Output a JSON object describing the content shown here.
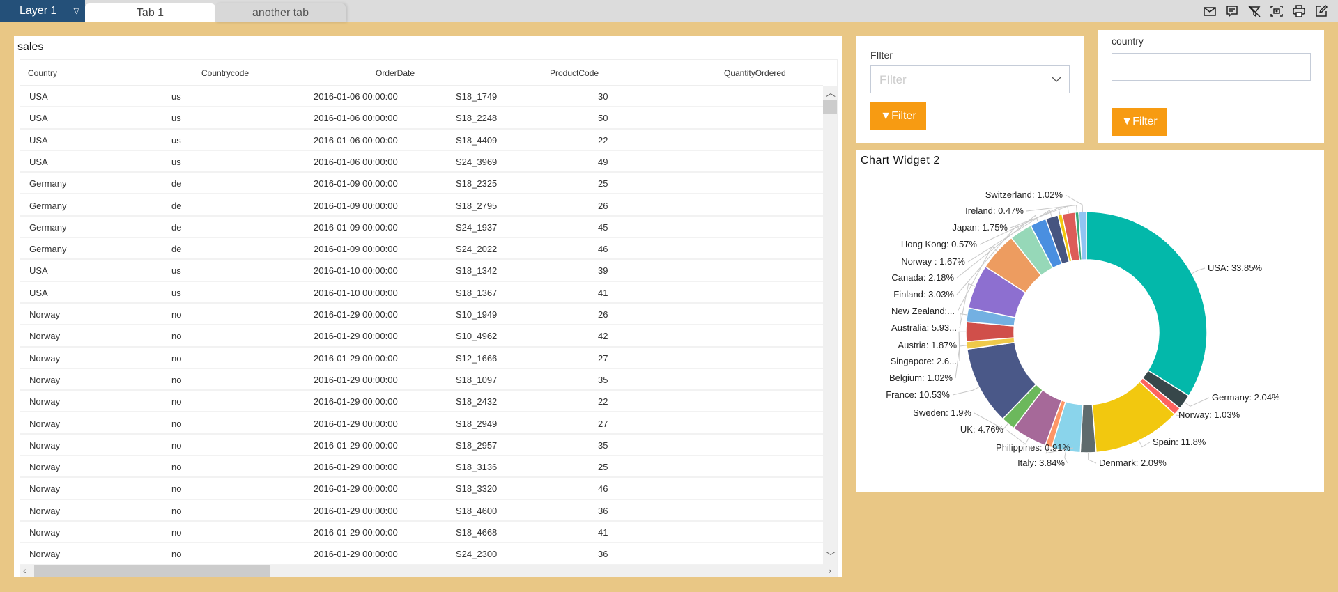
{
  "topbar": {
    "layer": "Layer 1",
    "tabs": [
      "Tab 1",
      "another tab"
    ],
    "icons": [
      "mail-icon",
      "comment-icon",
      "clear-filter-icon",
      "screenshot-icon",
      "print-icon",
      "edit-icon"
    ]
  },
  "sales": {
    "title": "sales",
    "columns": [
      "Country",
      "Countrycode",
      "OrderDate",
      "ProductCode",
      "QuantityOrdered"
    ],
    "rows": [
      [
        "USA",
        "us",
        "2016-01-06 00:00:00",
        "S18_1749",
        "30"
      ],
      [
        "USA",
        "us",
        "2016-01-06 00:00:00",
        "S18_2248",
        "50"
      ],
      [
        "USA",
        "us",
        "2016-01-06 00:00:00",
        "S18_4409",
        "22"
      ],
      [
        "USA",
        "us",
        "2016-01-06 00:00:00",
        "S24_3969",
        "49"
      ],
      [
        "Germany",
        "de",
        "2016-01-09 00:00:00",
        "S18_2325",
        "25"
      ],
      [
        "Germany",
        "de",
        "2016-01-09 00:00:00",
        "S18_2795",
        "26"
      ],
      [
        "Germany",
        "de",
        "2016-01-09 00:00:00",
        "S24_1937",
        "45"
      ],
      [
        "Germany",
        "de",
        "2016-01-09 00:00:00",
        "S24_2022",
        "46"
      ],
      [
        "USA",
        "us",
        "2016-01-10 00:00:00",
        "S18_1342",
        "39"
      ],
      [
        "USA",
        "us",
        "2016-01-10 00:00:00",
        "S18_1367",
        "41"
      ],
      [
        "Norway",
        "no",
        "2016-01-29 00:00:00",
        "S10_1949",
        "26"
      ],
      [
        "Norway",
        "no",
        "2016-01-29 00:00:00",
        "S10_4962",
        "42"
      ],
      [
        "Norway",
        "no",
        "2016-01-29 00:00:00",
        "S12_1666",
        "27"
      ],
      [
        "Norway",
        "no",
        "2016-01-29 00:00:00",
        "S18_1097",
        "35"
      ],
      [
        "Norway",
        "no",
        "2016-01-29 00:00:00",
        "S18_2432",
        "22"
      ],
      [
        "Norway",
        "no",
        "2016-01-29 00:00:00",
        "S18_2949",
        "27"
      ],
      [
        "Norway",
        "no",
        "2016-01-29 00:00:00",
        "S18_2957",
        "35"
      ],
      [
        "Norway",
        "no",
        "2016-01-29 00:00:00",
        "S18_3136",
        "25"
      ],
      [
        "Norway",
        "no",
        "2016-01-29 00:00:00",
        "S18_3320",
        "46"
      ],
      [
        "Norway",
        "no",
        "2016-01-29 00:00:00",
        "S18_4600",
        "36"
      ],
      [
        "Norway",
        "no",
        "2016-01-29 00:00:00",
        "S18_4668",
        "41"
      ],
      [
        "Norway",
        "no",
        "2016-01-29 00:00:00",
        "S24_2300",
        "36"
      ]
    ]
  },
  "filter1": {
    "label": "FIlter",
    "placeholder": "FIlter",
    "button": "Filter"
  },
  "filter2": {
    "label": "country",
    "value": "",
    "button": "Filter"
  },
  "accent": "#f79b12",
  "chart_data": {
    "type": "pie",
    "donut": true,
    "title": "Chart Widget 2",
    "unit": "%",
    "slices": [
      {
        "name": "USA",
        "value": 33.85,
        "label": "USA: 33.85%",
        "color": "#03b8aa"
      },
      {
        "name": "Germany",
        "value": 2.04,
        "label": "Germany: 2.04%",
        "color": "#37474a"
      },
      {
        "name": "Norway",
        "value": 1.03,
        "label": "Norway: 1.03%",
        "color": "#fd625e"
      },
      {
        "name": "Spain",
        "value": 11.8,
        "label": "Spain: 11.8%",
        "color": "#f2c80f"
      },
      {
        "name": "Denmark",
        "value": 2.09,
        "label": "Denmark: 2.09%",
        "color": "#5f6b6d"
      },
      {
        "name": "Italy",
        "value": 3.84,
        "label": "Italy: 3.84%",
        "color": "#8ad4eb"
      },
      {
        "name": "Philippines",
        "value": 0.91,
        "label": "Philippines: 0.91%",
        "color": "#fe9666"
      },
      {
        "name": "UK",
        "value": 4.76,
        "label": "UK: 4.76%",
        "color": "#a66999"
      },
      {
        "name": "Sweden",
        "value": 1.9,
        "label": "Sweden: 1.9%",
        "color": "#6cb85c"
      },
      {
        "name": "France",
        "value": 10.53,
        "label": "France: 10.53%",
        "color": "#4a5888"
      },
      {
        "name": "Belgium",
        "value": 1.02,
        "label": "Belgium: 1.02%",
        "color": "#efc94a"
      },
      {
        "name": "Singapore",
        "value": 2.6,
        "label": "Singapore: 2.6...",
        "color": "#d04f4a"
      },
      {
        "name": "Austria",
        "value": 1.87,
        "label": "Austria: 1.87%",
        "color": "#73b0e2"
      },
      {
        "name": "Australia",
        "value": 5.93,
        "label": "Australia: 5.93...",
        "color": "#8d6fd0"
      },
      {
        "name": "New Zealand",
        "value": 5.14,
        "label": "New Zealand:...",
        "color": "#ed9c60"
      },
      {
        "name": "Finland",
        "value": 3.03,
        "label": "Finland: 3.03%",
        "color": "#96d8b8"
      },
      {
        "name": "Canada",
        "value": 2.18,
        "label": "Canada: 2.18%",
        "color": "#4a8fe0"
      },
      {
        "name": "Norway ",
        "value": 1.67,
        "label": "Norway : 1.67%",
        "color": "#465580"
      },
      {
        "name": "Hong Kong",
        "value": 0.57,
        "label": "Hong Kong: 0.57%",
        "color": "#f2c80f"
      },
      {
        "name": "Japan",
        "value": 1.75,
        "label": "Japan: 1.75%",
        "color": "#dd5c58"
      },
      {
        "name": "Ireland",
        "value": 0.47,
        "label": "Ireland: 0.47%",
        "color": "#3aa878"
      },
      {
        "name": "Switzerland",
        "value": 1.02,
        "label": "Switzerland: 1.02%",
        "color": "#91c4f2"
      }
    ]
  }
}
